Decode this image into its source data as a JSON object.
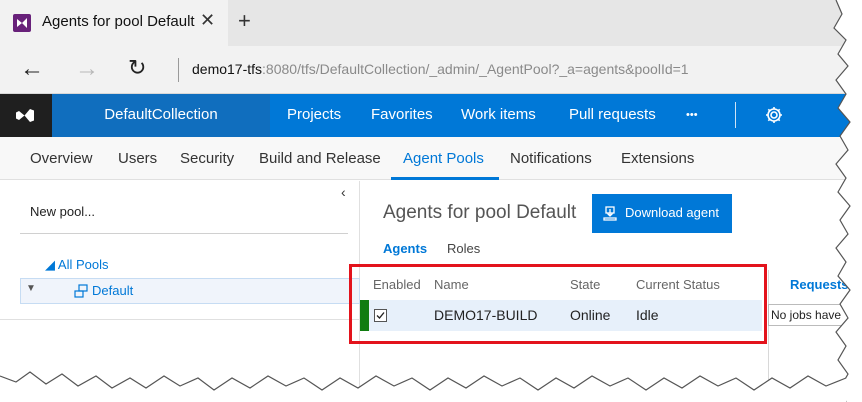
{
  "browser": {
    "tab_title": "Agents for pool Default",
    "tab_close": "✕",
    "new_tab": "+",
    "back": "←",
    "forward": "→",
    "refresh": "↻",
    "url_host": "demo17-tfs",
    "url_rest": ":8080/tfs/DefaultCollection/_admin/_AgentPool?_a=agents&poolId=1"
  },
  "topnav": {
    "collection": "DefaultCollection",
    "hubs": [
      "Projects",
      "Favorites",
      "Work items",
      "Pull requests",
      "•••"
    ],
    "settings_icon": "gear-icon",
    "background": "#0078d7"
  },
  "admin_tabs": {
    "items": [
      "Overview",
      "Users",
      "Security",
      "Build and Release",
      "Agent Pools",
      "Notifications",
      "Extensions"
    ],
    "active": "Agent Pools"
  },
  "left_pane": {
    "collapse": "‹",
    "new_pool": "New pool...",
    "all_pools": "◢ All Pools",
    "default_pool": "Default"
  },
  "main": {
    "title": "Agents for pool Default",
    "download_button": "Download agent",
    "subtabs": [
      "Agents",
      "Roles"
    ],
    "columns": [
      "Enabled",
      "Name",
      "State",
      "Current Status"
    ],
    "agent": {
      "enabled": true,
      "name": "DEMO17-BUILD",
      "state": "Online",
      "current_status": "Idle"
    },
    "requests_header": "Requests",
    "no_jobs": "No jobs have"
  },
  "colors": {
    "accent": "#0078d7",
    "highlight_border": "#e3131c",
    "online_bar": "#107c10"
  }
}
